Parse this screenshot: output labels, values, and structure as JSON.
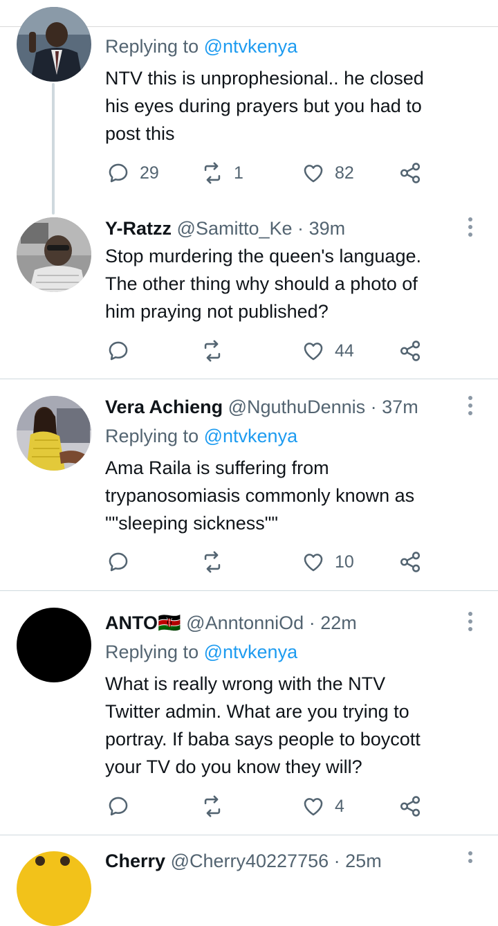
{
  "tweets": [
    {
      "reply_prefix": "Replying to",
      "reply_mention": "@ntvkenya",
      "lines": [
        "NTV this is unprophesional.. he closed",
        "his eyes during prayers but you had to",
        "post this"
      ],
      "replies": "29",
      "retweets": "1",
      "likes": "82"
    },
    {
      "name": "Y-Ratzz",
      "handle": "@Samitto_Ke",
      "separator": "·",
      "time": "39m",
      "lines": [
        "Stop murdering the queen's language.",
        "The other thing why should a photo of",
        "him praying not published?"
      ],
      "replies": "",
      "retweets": "",
      "likes": "44"
    },
    {
      "name": "Vera Achieng",
      "handle": "@NguthuDennis",
      "separator": "·",
      "time": "37m",
      "reply_prefix": "Replying to",
      "reply_mention": "@ntvkenya",
      "lines": [
        "Ama Raila is suffering from",
        "trypanosomiasis commonly known as",
        "\"\"sleeping sickness\"\""
      ],
      "replies": "",
      "retweets": "",
      "likes": "10"
    },
    {
      "name": "ANTO",
      "flag": "🇰🇪",
      "handle": "@AnntonniOd",
      "separator": "·",
      "time": "22m",
      "reply_prefix": "Replying to",
      "reply_mention": "@ntvkenya",
      "lines": [
        "What is really wrong with the NTV",
        "Twitter admin. What are you trying to",
        "portray. If baba says people to boycott",
        "your TV do you know they will?"
      ],
      "replies": "",
      "retweets": "",
      "likes": "4"
    },
    {
      "name": "Cherry",
      "handle": "@Cherry40227756",
      "separator": "·",
      "time": "25m"
    }
  ],
  "icons": {
    "reply": "reply-icon",
    "retweet": "retweet-icon",
    "like": "heart-icon",
    "share": "share-icon",
    "more": "more-vertical-icon"
  },
  "colors": {
    "link": "#1d9bf0",
    "secondary": "#536471",
    "text": "#0f1419",
    "divider": "#cfd9de"
  }
}
